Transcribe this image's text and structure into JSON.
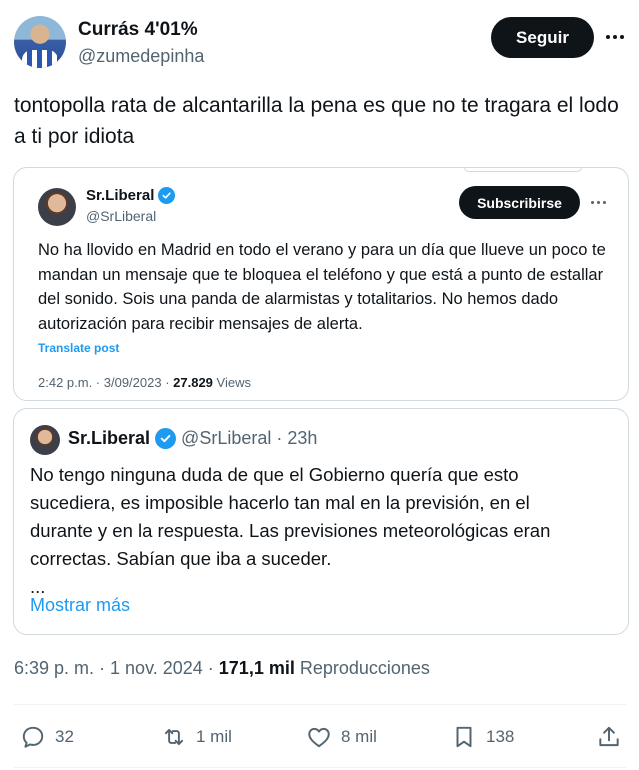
{
  "author": {
    "name": "Currás 4'01%",
    "handle": "@zumedepinha"
  },
  "buttons": {
    "follow": "Seguir"
  },
  "tweet": {
    "text": "tontopolla rata de alcantarilla la pena es que no te tragara el lodo a ti por idiota"
  },
  "embedded_screenshot": {
    "name": "Sr.Liberal",
    "handle": "@SrLiberal",
    "subscribe": "Subscribirse",
    "text": "No ha llovido en Madrid en todo el verano y para un día que llueve un poco te mandan un mensaje que te bloquea el teléfono y que está a punto de estallar del sonido. Sois una panda de alarmistas y totalitarios. No hemos dado autorización para recibir mensajes de alerta.",
    "translate": "Translate post",
    "time": "2:42 p.m. · 3/09/2023 · ",
    "views_count": "27.829",
    "views_label": " Views"
  },
  "quoted_post": {
    "name": "Sr.Liberal",
    "handle": "@SrLiberal",
    "age": "· 23h",
    "text_lines": [
      "No tengo ninguna duda de que el Gobierno quería que esto",
      "sucediera, es imposible hacerlo tan mal en la previsión, en el",
      "durante y en la respuesta. Las previsiones meteorológicas eran",
      "correctas. Sabían que iba a suceder.",
      "..."
    ],
    "show_more": "Mostrar más"
  },
  "meta": {
    "time": "6:39 p. m. · 1 nov. 2024 · ",
    "views_count": "171,1 mil",
    "views_label": " Reproducciones"
  },
  "actions": {
    "replies": "32",
    "reposts": "1 mil",
    "likes": "8 mil",
    "bookmarks": "138"
  },
  "colors": {
    "accent": "#1d9bf0",
    "text": "#0f1419",
    "muted": "#536471",
    "border": "#cfd9de"
  }
}
